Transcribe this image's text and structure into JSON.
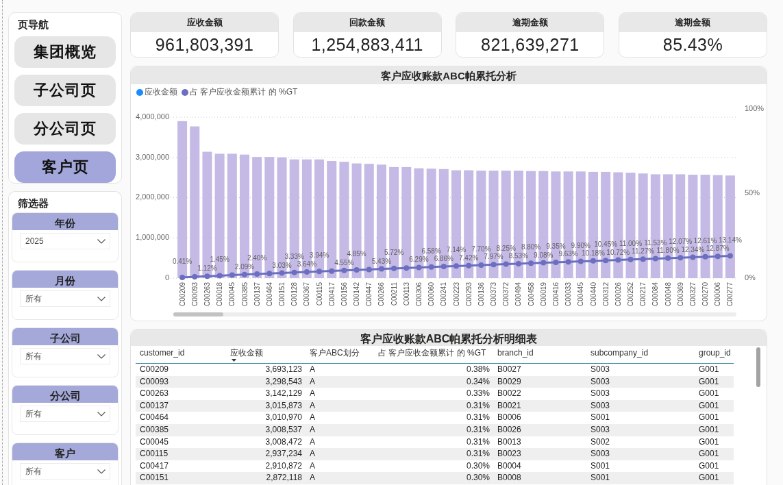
{
  "nav": {
    "title": "页导航",
    "items": [
      {
        "label": "集团概览",
        "selected": false
      },
      {
        "label": "子公司页",
        "selected": false
      },
      {
        "label": "分公司页",
        "selected": false
      },
      {
        "label": "客户页",
        "selected": true
      }
    ]
  },
  "filters": {
    "title": "筛选器",
    "slicers": [
      {
        "title": "年份",
        "value": "2025"
      },
      {
        "title": "月份",
        "value": "所有"
      },
      {
        "title": "子公司",
        "value": "所有"
      },
      {
        "title": "分公司",
        "value": "所有"
      },
      {
        "title": "客户",
        "value": "所有"
      }
    ]
  },
  "kpis": [
    {
      "title": "应收金额",
      "value": "961,803,391"
    },
    {
      "title": "回款金额",
      "value": "1,254,883,411"
    },
    {
      "title": "逾期金额",
      "value": "821,639,271"
    },
    {
      "title": "逾期金额",
      "value": "85.43%"
    }
  ],
  "chart": {
    "title": "客户应收账款ABC帕累托分析",
    "legend": [
      {
        "label": "应收金额",
        "color": "#1a8cff"
      },
      {
        "label": "占 客户应收金额累计 的 %GT",
        "color": "#6b6fc0"
      }
    ],
    "chart_data": {
      "type": "bar",
      "grid": true,
      "marker": "circle",
      "categories": [
        "C00209",
        "C00093",
        "C00263",
        "C00018",
        "C00045",
        "C00385",
        "C00137",
        "C00464",
        "C00151",
        "C00128",
        "C00367",
        "C00115",
        "C00417",
        "C00156",
        "C00142",
        "C00447",
        "C00266",
        "C00211",
        "C00113",
        "C00306",
        "C00060",
        "C00241",
        "C00223",
        "C00293",
        "C00136",
        "C00373",
        "C00372",
        "C00494",
        "C00458",
        "C00019",
        "C00416",
        "C00033",
        "C00445",
        "C00440",
        "C00312",
        "C00026",
        "C00252",
        "C00217",
        "C00084",
        "C00048",
        "C00369",
        "C00327",
        "C00270",
        "C00006",
        "C00277"
      ],
      "ylim": [
        0,
        4000000
      ],
      "yticks": [
        {
          "value": 0,
          "label": "0"
        },
        {
          "value": 1000000,
          "label": "1,000,000"
        },
        {
          "value": 2000000,
          "label": "2,000,000"
        },
        {
          "value": 3000000,
          "label": "3,000,000"
        },
        {
          "value": 4000000,
          "label": "4,000,000"
        }
      ],
      "y2lim": [
        0,
        100
      ],
      "y2ticks": [
        {
          "value": 0,
          "label": "0%"
        },
        {
          "value": 50,
          "label": "50%"
        },
        {
          "value": 100,
          "label": "100%"
        }
      ],
      "series": [
        {
          "type": "bar",
          "color": "#c5b9e6",
          "values": [
            3900000,
            3770000,
            3140000,
            3090000,
            3090000,
            3070000,
            3010000,
            3010000,
            3000000,
            2950000,
            2950000,
            2950000,
            2910000,
            2890000,
            2850000,
            2840000,
            2820000,
            2760000,
            2760000,
            2730000,
            2720000,
            2710000,
            2680000,
            2680000,
            2670000,
            2670000,
            2670000,
            2670000,
            2660000,
            2660000,
            2650000,
            2650000,
            2650000,
            2640000,
            2640000,
            2630000,
            2620000,
            2600000,
            2580000,
            2580000,
            2580000,
            2570000,
            2570000,
            2560000,
            2550000
          ]
        },
        {
          "type": "line",
          "axis": "y2",
          "color": "#6b6fc0",
          "values": [
            0.41,
            0.8,
            1.12,
            1.45,
            1.8,
            2.09,
            2.4,
            2.7,
            3.03,
            3.33,
            3.64,
            3.94,
            4.2,
            4.55,
            4.85,
            5.1,
            5.43,
            5.72,
            6.0,
            6.29,
            6.58,
            6.86,
            7.14,
            7.42,
            7.7,
            7.97,
            8.25,
            8.53,
            8.8,
            9.08,
            9.35,
            9.63,
            9.9,
            10.18,
            10.45,
            10.72,
            11.0,
            11.27,
            11.53,
            11.8,
            12.07,
            12.34,
            12.61,
            12.87,
            13.14
          ],
          "value_labels": [
            "0.41%",
            null,
            "1.12%",
            "1.45%",
            null,
            "2.09%",
            "2.40%",
            null,
            "3.03%",
            "3.33%",
            "3.64%",
            "3.94%",
            null,
            "4.55%",
            "4.85%",
            null,
            "5.43%",
            "5.72%",
            null,
            "6.29%",
            "6.58%",
            "6.86%",
            "7.14%",
            "7.42%",
            "7.70%",
            "7.97%",
            "8.25%",
            "8.53%",
            "8.80%",
            "9.08%",
            "9.35%",
            "9.63%",
            "9.90%",
            "10.18%",
            "10.45%",
            "10.72%",
            "11.00%",
            "11.27%",
            "11.53%",
            "11.80%",
            "12.07%",
            "12.34%",
            "12.61%",
            "12.87%",
            "13.14%"
          ]
        }
      ]
    }
  },
  "table": {
    "title": "客户应收账款ABC帕累托分析明细表",
    "columns": [
      {
        "label": "customer_id",
        "kind": "text",
        "sorted": false
      },
      {
        "label": "应收金额",
        "kind": "number",
        "sorted": true
      },
      {
        "label": "客户ABC划分",
        "kind": "text",
        "sorted": false
      },
      {
        "label": "占 客户应收金额累计 的 %GT",
        "kind": "number",
        "sorted": false
      },
      {
        "label": "branch_id",
        "kind": "text",
        "sorted": false
      },
      {
        "label": "subcompany_id",
        "kind": "text",
        "sorted": false
      },
      {
        "label": "group_id",
        "kind": "text",
        "sorted": false
      }
    ],
    "rows": [
      [
        "C00209",
        "3,693,123",
        "A",
        "0.38%",
        "B0027",
        "S003",
        "G001"
      ],
      [
        "C00093",
        "3,298,543",
        "A",
        "0.34%",
        "B0029",
        "S003",
        "G001"
      ],
      [
        "C00263",
        "3,142,129",
        "A",
        "0.33%",
        "B0022",
        "S003",
        "G001"
      ],
      [
        "C00137",
        "3,015,873",
        "A",
        "0.31%",
        "B0021",
        "S003",
        "G001"
      ],
      [
        "C00464",
        "3,010,970",
        "A",
        "0.31%",
        "B0006",
        "S001",
        "G001"
      ],
      [
        "C00385",
        "3,008,537",
        "A",
        "0.31%",
        "B0026",
        "S003",
        "G001"
      ],
      [
        "C00045",
        "3,008,472",
        "A",
        "0.31%",
        "B0013",
        "S002",
        "G001"
      ],
      [
        "C00115",
        "2,937,234",
        "A",
        "0.31%",
        "B0023",
        "S003",
        "G001"
      ],
      [
        "C00417",
        "2,910,872",
        "A",
        "0.30%",
        "B0004",
        "S001",
        "G001"
      ],
      [
        "C00151",
        "2,872,118",
        "A",
        "0.30%",
        "B0008",
        "S001",
        "G001"
      ]
    ]
  }
}
